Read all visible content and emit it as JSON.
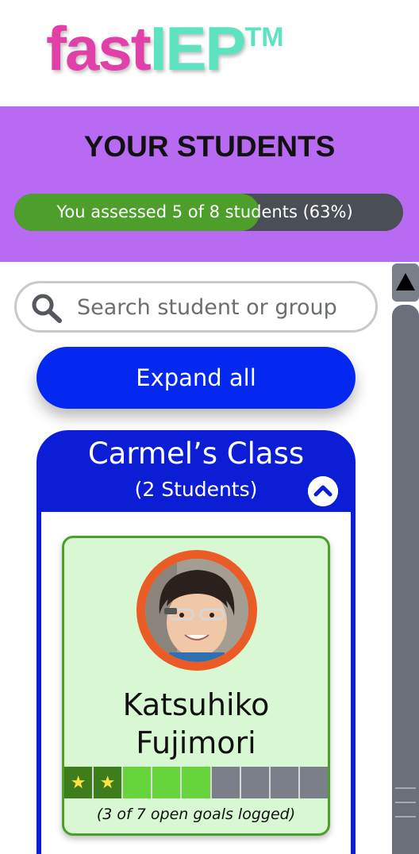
{
  "logo": {
    "part1": "fast",
    "part2": "IEP",
    "tm": "TM"
  },
  "page": {
    "title": "YOUR STUDENTS",
    "progress": {
      "text": "You assessed 5 of 8 students (63%)",
      "assessed": 5,
      "total": 8,
      "fraction": 0.63
    }
  },
  "search": {
    "placeholder": "Search student or group"
  },
  "expand_all_label": "Expand all",
  "group": {
    "title": "Carmel’s Class",
    "subtitle": "(2 Students)",
    "student": {
      "first_name": "Katsuhiko",
      "last_name": "Fujimori",
      "goals": [
        "star",
        "star",
        "logged",
        "logged",
        "logged",
        "open",
        "open",
        "open",
        "open"
      ],
      "goal_caption": "(3 of 7 open goals logged)",
      "star_glyph": "★"
    }
  },
  "colors": {
    "purple": "#b96af2",
    "accent_blue": "#0428f0",
    "green": "#4e9e2c",
    "card_bg": "#d8f8d3",
    "avatar_ring": "#ea5b25",
    "logo_pink": "#e040a8",
    "logo_teal": "#5de3c0"
  },
  "icons": {
    "search": "search-icon",
    "collapse": "chevron-up-icon",
    "scroll_up": "triangle-up-icon",
    "star": "star-icon"
  }
}
